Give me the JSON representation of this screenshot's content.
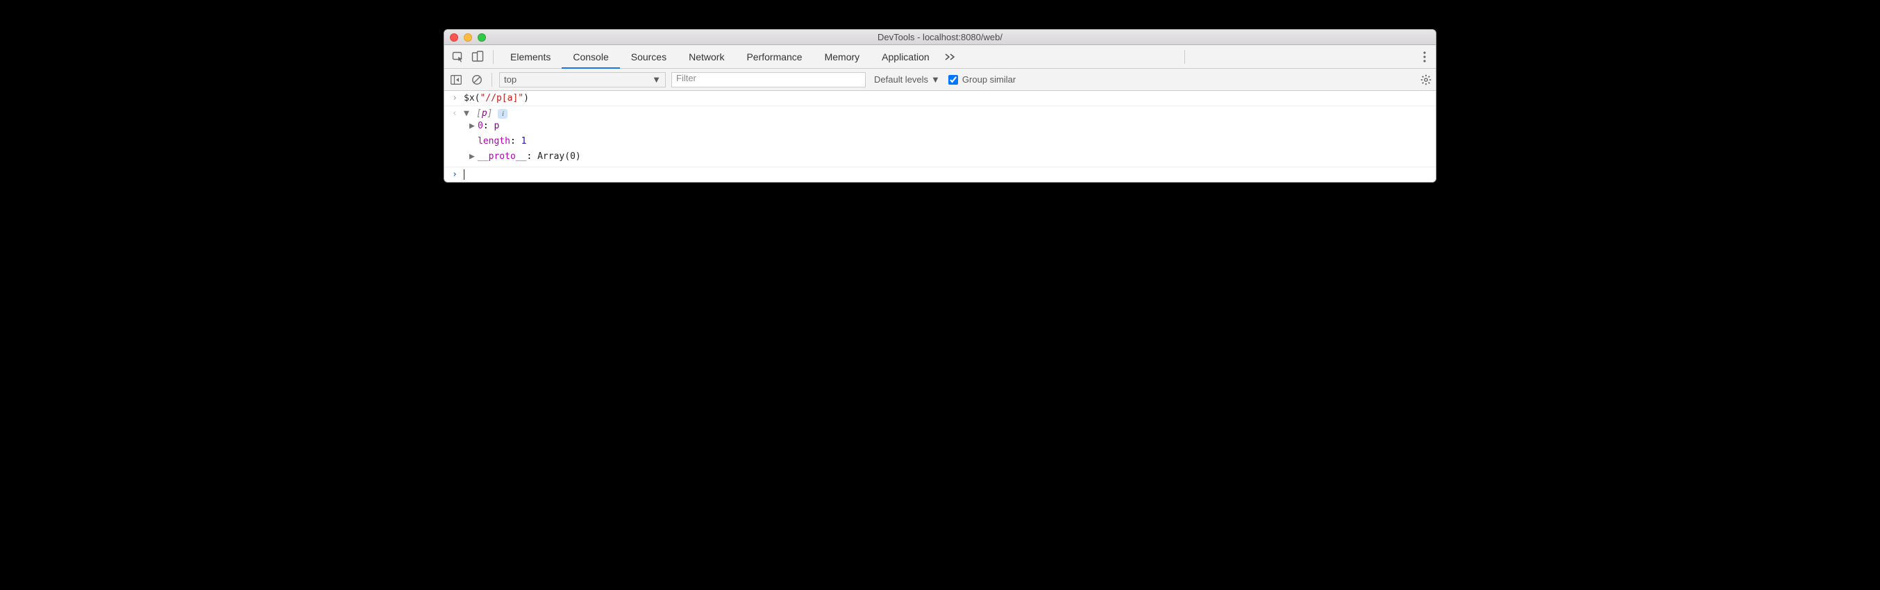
{
  "window": {
    "title": "DevTools - localhost:8080/web/"
  },
  "tabs": {
    "items": [
      "Elements",
      "Console",
      "Sources",
      "Network",
      "Performance",
      "Memory",
      "Application"
    ],
    "active_index": 1
  },
  "toolbar": {
    "context": "top",
    "filter_placeholder": "Filter",
    "levels_label": "Default levels",
    "group_similar_label": "Group similar",
    "group_similar_checked": true
  },
  "console": {
    "input": {
      "fn": "$x",
      "open": "(",
      "arg": "\"//p[a]\"",
      "close": ")"
    },
    "result": {
      "preview_open": "[",
      "preview_item": "p",
      "preview_close": "]",
      "lines": [
        {
          "disclose": "▶",
          "key": "0",
          "sep": ": ",
          "val": "p",
          "val_is_elem": true
        },
        {
          "disclose": "",
          "key": "length",
          "sep": ": ",
          "val": "1",
          "val_is_elem": false
        },
        {
          "disclose": "▶",
          "key": "__proto__",
          "sep": ": ",
          "val": "Array(0)",
          "val_is_elem": false,
          "plainval": true
        }
      ]
    }
  }
}
